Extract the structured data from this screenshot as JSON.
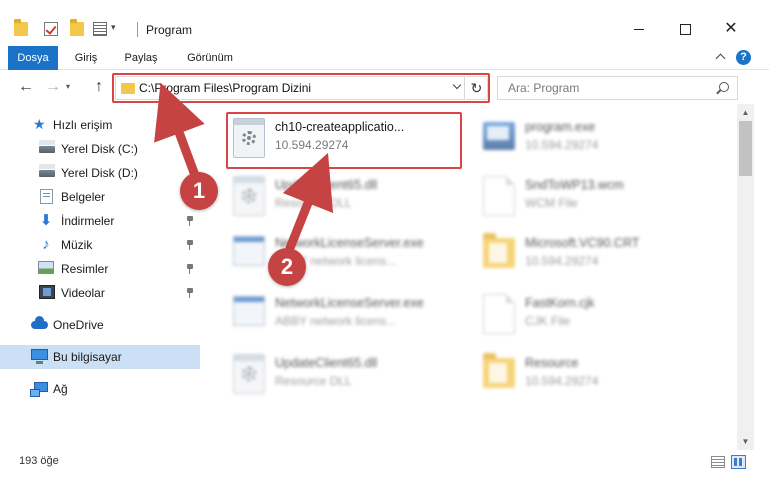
{
  "window": {
    "title": "Program",
    "minimize_label": "",
    "close_label": "✕"
  },
  "ribbon": {
    "tabs": [
      {
        "label": "Dosya",
        "active": true
      },
      {
        "label": "Giriş"
      },
      {
        "label": "Paylaş"
      },
      {
        "label": "Görünüm"
      }
    ],
    "help_label": "?"
  },
  "navbar": {
    "back_label": "←",
    "forward_label": "→",
    "up_label": "↑",
    "address_path": "C:\\Program Files\\Program Dizini",
    "refresh_label": "↻",
    "search_placeholder": "Ara: Program"
  },
  "sidebar": {
    "items": [
      {
        "label": "Hızlı erişim",
        "icon": "star-icon"
      },
      {
        "label": "Yerel Disk (C:)",
        "icon": "drive-icon"
      },
      {
        "label": "Yerel Disk (D:)",
        "icon": "drive-icon"
      },
      {
        "label": "Belgeler",
        "icon": "documents-icon"
      },
      {
        "label": "İndirmeler",
        "icon": "downloads-icon",
        "pinned": true
      },
      {
        "label": "Müzik",
        "icon": "music-icon",
        "pinned": true
      },
      {
        "label": "Resimler",
        "icon": "pictures-icon",
        "pinned": true
      },
      {
        "label": "Videolar",
        "icon": "videos-icon",
        "pinned": true
      },
      {
        "label": "OneDrive",
        "icon": "cloud-icon"
      },
      {
        "label": "Bu bilgisayar",
        "icon": "computer-icon",
        "selected": true
      },
      {
        "label": "Ağ",
        "icon": "network-icon"
      }
    ]
  },
  "files": [
    {
      "name": "ch10-createapplicatio...",
      "sub": "10.594.29274",
      "icon": "exe-icon",
      "highlighted": true
    },
    {
      "name": "program.exe",
      "sub": "10.594.29274",
      "icon": "program-icon"
    },
    {
      "name": "UpdateClient65.dll",
      "sub": "Resource DLL",
      "icon": "exe-icon"
    },
    {
      "name": "SndToWP13.wcm",
      "sub": "WCM File",
      "icon": "doc-icon"
    },
    {
      "name": "NetworkLicenseServer.exe",
      "sub": "ABBY network licens...",
      "icon": "window-icon"
    },
    {
      "name": "Microsoft.VC90.CRT",
      "sub": "10.594.29274",
      "icon": "folder-icon"
    },
    {
      "name": "NetworkLicenseServer.exe",
      "sub": "ABBY network licens...",
      "icon": "window-icon"
    },
    {
      "name": "FastKorn.cjk",
      "sub": "CJK File",
      "icon": "doc-icon"
    },
    {
      "name": "UpdateClient65.dll",
      "sub": "Resource DLL",
      "icon": "exe-icon"
    },
    {
      "name": "Resource",
      "sub": "10.594.29274",
      "icon": "folder-icon"
    }
  ],
  "status": {
    "item_count": "193 öğe"
  },
  "annotations": {
    "badge_1": "1",
    "badge_2": "2",
    "color": "#c64343"
  },
  "colors": {
    "accent": "#1a73c6",
    "highlight": "#d74545",
    "selection": "#cce0f5"
  }
}
